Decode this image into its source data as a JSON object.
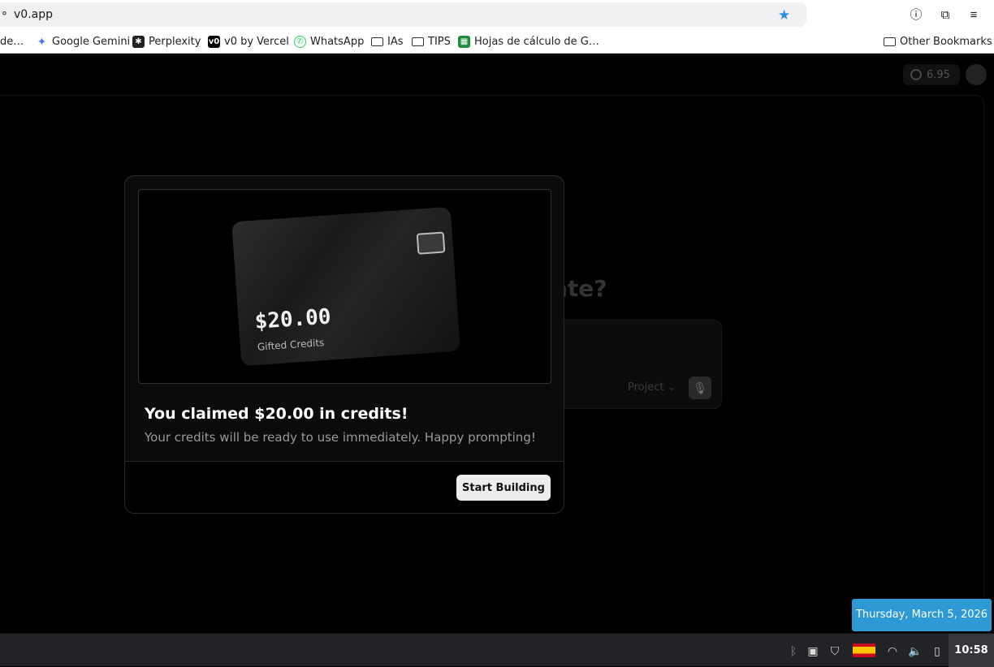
{
  "browser": {
    "url": "v0.app",
    "bookmarks": [
      {
        "label": "de…",
        "icon": "none"
      },
      {
        "label": "Google Gemini",
        "icon": "gemini-icon"
      },
      {
        "label": "Perplexity",
        "icon": "perplexity-icon"
      },
      {
        "label": "v0 by Vercel",
        "icon": "v0-icon"
      },
      {
        "label": "WhatsApp",
        "icon": "whatsapp-icon"
      },
      {
        "label": "IAs",
        "icon": "folder-icon"
      },
      {
        "label": "TIPS",
        "icon": "folder-icon"
      },
      {
        "label": "Hojas de cálculo de G…",
        "icon": "sheets-icon"
      }
    ],
    "other_bookmarks": "Other Bookmarks"
  },
  "app": {
    "credits_value": "6.95",
    "heading_partial": "ate?",
    "project_label": "Project"
  },
  "modal": {
    "card_amount": "$20.00",
    "card_label": "Gifted Credits",
    "title": "You claimed $20.00 in credits!",
    "subtitle": "Your credits will be ready to use immediately. Happy prompting!",
    "button_label": "Start Building"
  },
  "taskbar": {
    "time": "10:58",
    "date_tooltip": "Thursday, March 5, 2026"
  },
  "colors": {
    "accent_star": "#2a8fde",
    "tooltip_bg": "#2d9ad6"
  }
}
